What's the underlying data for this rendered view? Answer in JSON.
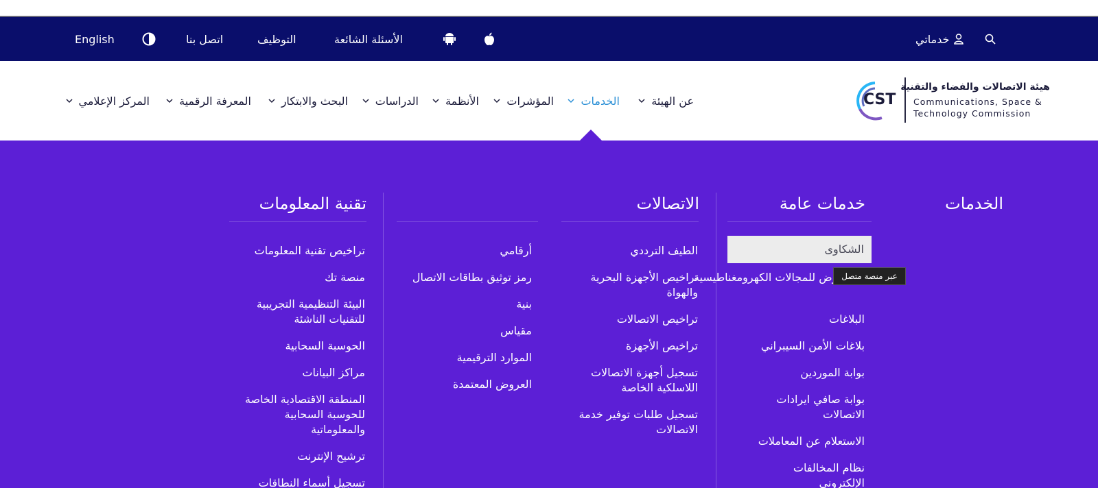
{
  "utility_bar": {
    "english_label": "English",
    "contact_label": "اتصل بنا",
    "jobs_label": "التوظيف",
    "faq_label": "الأسئلة الشائعة",
    "my_services_label": "خدماتي",
    "colors": {
      "background": "#0a0e6b"
    }
  },
  "logo": {
    "mark": "CST",
    "name_ar": "هيئة الاتصالات والفضاء والتقنية",
    "name_en_line1": "Communications, Space &",
    "name_en_line2": "Technology Commission"
  },
  "main_nav": {
    "items": [
      {
        "label": "عن الهيئة"
      },
      {
        "label": "الخدمات",
        "active": true
      },
      {
        "label": "المؤشرات"
      },
      {
        "label": "الأنظمة"
      },
      {
        "label": "الدراسات"
      },
      {
        "label": "البحث والابتكار"
      },
      {
        "label": "المعرفة الرقمية"
      },
      {
        "label": "المركز الإعلامي"
      }
    ],
    "colors": {
      "active": "#2a8fd6",
      "text": "#1b1b3a"
    }
  },
  "mega_menu": {
    "heading": "الخدمات",
    "colors": {
      "background": "#5c1fd6",
      "hover_bg": "#ececec"
    },
    "columns": [
      {
        "title": "خدمات عامة",
        "links": [
          "الشكاوى",
          "ل التعرض للمجالات الكهرومغناطيسية",
          "البلاغات",
          "بلاغات الأمن السيبراني",
          "بوابة الموردين",
          "بوابة صافي ايرادات الاتصالات",
          "الاستعلام عن المعاملات",
          "نظام المخالفات الإلكتروني"
        ]
      },
      {
        "title": "الاتصالات",
        "links": [
          "الطيف الترددي",
          "تراخيص الأجهزة البحرية والهواة",
          "تراخيص الاتصالات",
          "تراخيص الأجهزة",
          "تسجيل أجهزة الاتصالات اللاسلكية الخاصة",
          "تسجيل طلبات توفير خدمة الاتصالات"
        ]
      },
      {
        "title": "",
        "links": [
          "أرقامي",
          "رمز توثيق بطاقات الاتصال",
          "بنية",
          "مقياس",
          "الموارد الترقيمية",
          "العروض المعتمدة"
        ]
      },
      {
        "title": "تقنية المعلومات",
        "links": [
          "تراخيص تقنية المعلومات",
          "منصة تك",
          "البيئة التنظيمية التجريبية للتقنيات الناشئة",
          "الحوسبة السحابية",
          "مراكز البيانات",
          "المنطقة الاقتصادية الخاصة للحوسبة السحابية والمعلوماتية",
          "ترشيح الإنترنت",
          "تسجيل أسماء النطاقات"
        ]
      }
    ],
    "tooltip": "عبر منصة متصل"
  }
}
